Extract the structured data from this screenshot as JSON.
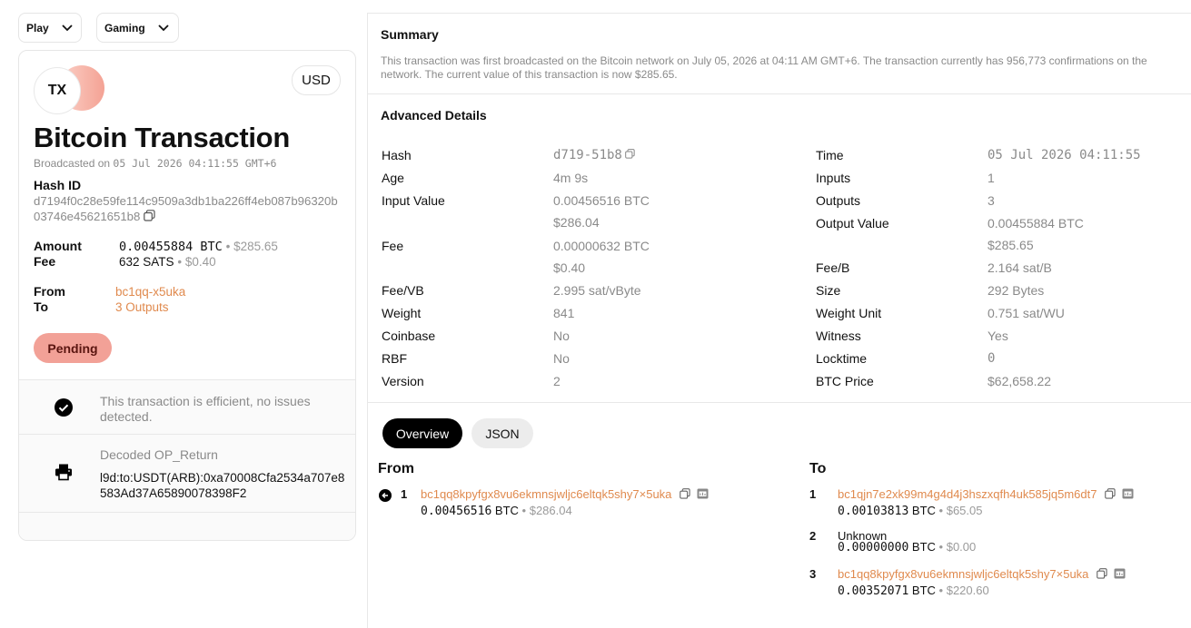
{
  "top_dropdowns": {
    "play": "Play",
    "gaming": "Gaming"
  },
  "card": {
    "logo_text": "TX",
    "currency": "USD",
    "title": "Bitcoin Transaction",
    "broadcast_prefix": "Broadcasted on",
    "broadcast_date": "05 Jul 2026 04:11:55 GMT+6",
    "hash_label": "Hash ID",
    "hash_value": "d7194f0c28e59fe114c9509a3db1ba226ff4eb087b96320b03746e45621651b8",
    "amount_label": "Amount",
    "amount_btc": "0.00455884 BTC",
    "amount_usd": "$285.65",
    "fee_label": "Fee",
    "fee_sats": "632 SATS",
    "fee_usd": "$0.40",
    "from_label": "From",
    "from_value": "bc1qq-x5uka",
    "to_label": "To",
    "to_value": "3 Outputs",
    "status": "Pending",
    "efficiency_text_1": "This transaction is efficient, no issues",
    "efficiency_text_2": "detected.",
    "op_return_label": "Decoded OP_Return",
    "op_return_value": "l9d:to:USDT(ARB):0xa70008Cfa2534a707e8583Ad37A65890078398F2",
    "bullet": "•"
  },
  "summary": {
    "title": "Summary",
    "line1": "This transaction was first broadcasted on the Bitcoin network on July 05, 2026 at 04:11 AM GMT+6. The transaction currently has 956,773 confirmations on the",
    "line2": "network. The current value of this transaction is now $285.65."
  },
  "advanced": {
    "title": "Advanced Details",
    "left": [
      {
        "label": "Hash",
        "value": "d719-51b8",
        "value2": ""
      },
      {
        "label": "Age",
        "value": "4m 9s",
        "value2": ""
      },
      {
        "label": "Input Value",
        "value": "0.00456516 BTC",
        "value2": "$286.04"
      },
      {
        "label": "Fee",
        "value": "0.00000632 BTC",
        "value2": "$0.40"
      },
      {
        "label": "Fee/VB",
        "value": "2.995 sat/vByte",
        "value2": ""
      },
      {
        "label": "Weight",
        "value": "841",
        "value2": ""
      },
      {
        "label": "Coinbase",
        "value": "No",
        "value2": ""
      },
      {
        "label": "RBF",
        "value": "No",
        "value2": ""
      },
      {
        "label": "Version",
        "value": "2",
        "value2": ""
      }
    ],
    "right": [
      {
        "label": "Time",
        "value": "05 Jul 2026 04:11:55",
        "value2": ""
      },
      {
        "label": "Inputs",
        "value": "1",
        "value2": ""
      },
      {
        "label": "Outputs",
        "value": "3",
        "value2": ""
      },
      {
        "label": "Output Value",
        "value": "0.00455884 BTC",
        "value2": "$285.65"
      },
      {
        "label": "Fee/B",
        "value": "2.164 sat/B",
        "value2": ""
      },
      {
        "label": "Size",
        "value": "292 Bytes",
        "value2": ""
      },
      {
        "label": "Weight Unit",
        "value": "0.751 sat/WU",
        "value2": ""
      },
      {
        "label": "Witness",
        "value": "Yes",
        "value2": ""
      },
      {
        "label": "Locktime",
        "value": "0",
        "value2": ""
      },
      {
        "label": "BTC Price",
        "value": "$62,658.22",
        "value2": ""
      }
    ]
  },
  "tabs": {
    "overview": "Overview",
    "json": "JSON"
  },
  "io": {
    "from_title": "From",
    "to_title": "To",
    "inputs": [
      {
        "index": "1",
        "address": "bc1qq8kpyfgx8vu6ekmnsjwljc6eltqk5shy7×5uka",
        "btc": "0.00456516",
        "unit": "BTC",
        "usd": "$286.04"
      }
    ],
    "outputs": [
      {
        "index": "1",
        "address": "bc1qjn7e2xk99m4g4d4j3hszxqfh4uk585jq5m6dt7",
        "btc": "0.00103813",
        "unit": "BTC",
        "usd": "$65.05"
      },
      {
        "index": "2",
        "address": "Unknown",
        "btc": "0.00000000",
        "unit": "BTC",
        "usd": "$0.00"
      },
      {
        "index": "3",
        "address": "bc1qq8kpyfgx8vu6ekmnsjwljc6eltqk5shy7×5uka",
        "btc": "0.00352071",
        "unit": "BTC",
        "usd": "$220.60"
      }
    ]
  }
}
